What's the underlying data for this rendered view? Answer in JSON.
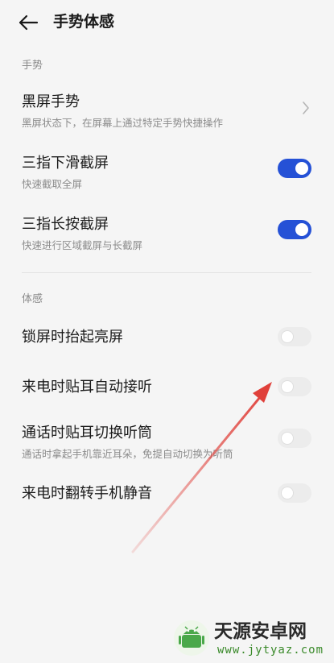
{
  "header": {
    "title": "手势体感",
    "back_icon": "back-arrow-icon"
  },
  "sections": [
    {
      "label": "手势",
      "items": [
        {
          "title": "黑屏手势",
          "subtitle": "黑屏状态下，在屏幕上通过特定手势快捷操作",
          "control": "chevron",
          "icon": "chevron-right-icon"
        },
        {
          "title": "三指下滑截屏",
          "subtitle": "快速截取全屏",
          "control": "toggle",
          "on": true
        },
        {
          "title": "三指长按截屏",
          "subtitle": "快速进行区域截屏与长截屏",
          "control": "toggle",
          "on": true
        }
      ]
    },
    {
      "label": "体感",
      "items": [
        {
          "title": "锁屏时抬起亮屏",
          "control": "toggle",
          "on": false
        },
        {
          "title": "来电时贴耳自动接听",
          "control": "toggle",
          "on": false
        },
        {
          "title": "通话时贴耳切换听筒",
          "subtitle": "通话时拿起手机靠近耳朵，免提自动切换为听筒",
          "control": "toggle",
          "on": false
        },
        {
          "title": "来电时翻转手机静音",
          "control": "toggle",
          "on": false
        }
      ]
    }
  ],
  "watermark": {
    "title": "天源安卓网",
    "url": "www.jytyaz.com"
  },
  "colors": {
    "toggle_on": "#2551d6",
    "toggle_off": "#ececec",
    "annotation_arrow": "#e0403a",
    "background": "#f5f5f5"
  }
}
